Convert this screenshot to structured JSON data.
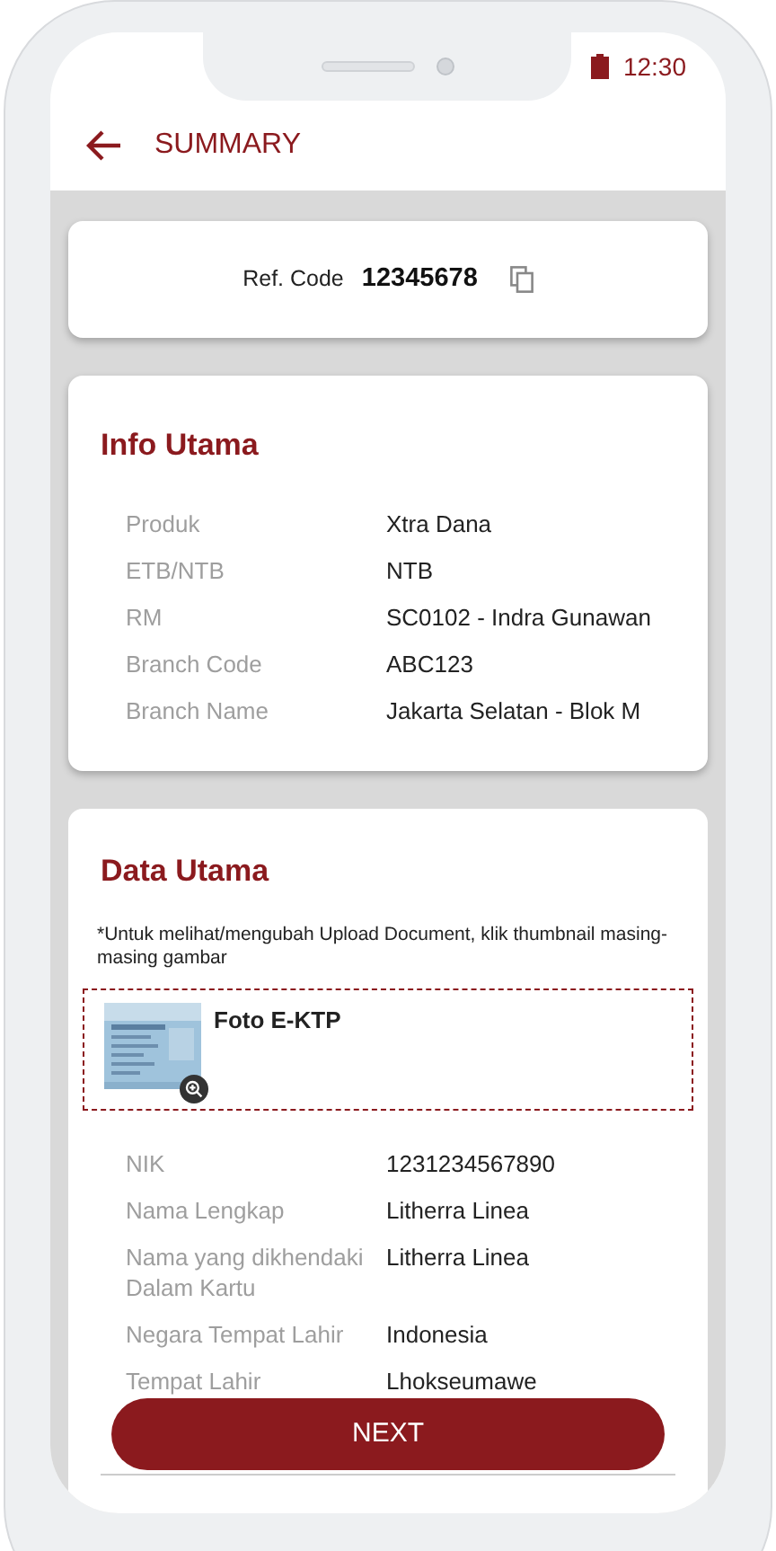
{
  "status_bar": {
    "time": "12:30"
  },
  "header": {
    "title": "SUMMARY"
  },
  "ref": {
    "label": "Ref. Code",
    "code": "12345678"
  },
  "info_utama": {
    "title": "Info Utama",
    "rows": [
      {
        "label": "Produk",
        "value": "Xtra Dana"
      },
      {
        "label": "ETB/NTB",
        "value": "NTB"
      },
      {
        "label": "RM",
        "value": "SC0102 - Indra Gunawan"
      },
      {
        "label": "Branch Code",
        "value": "ABC123"
      },
      {
        "label": "Branch Name",
        "value": "Jakarta Selatan - Blok M"
      }
    ]
  },
  "data_utama": {
    "title": "Data Utama",
    "note": "*Untuk melihat/mengubah Upload Document, klik thumbnail masing-masing gambar",
    "documents": [
      {
        "label": "Foto E-KTP"
      }
    ],
    "rows": [
      {
        "label": "NIK",
        "value": "1231234567890"
      },
      {
        "label": "Nama Lengkap",
        "value": "Litherra Linea"
      },
      {
        "label": "Nama yang dikhendaki Dalam Kartu",
        "value": "Litherra Linea"
      },
      {
        "label": "Negara Tempat Lahir",
        "value": "Indonesia"
      },
      {
        "label": "Tempat Lahir",
        "value": "Lhokseumawe"
      }
    ]
  },
  "next_button": {
    "label": "NEXT"
  }
}
